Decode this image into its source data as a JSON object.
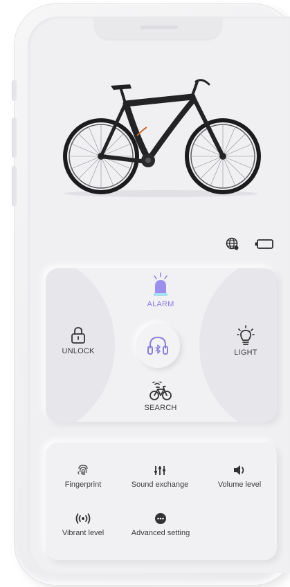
{
  "controls": {
    "alarm": "ALARM",
    "unlock": "UNLOCK",
    "light": "LIGHT",
    "search": "SEARCH"
  },
  "settings": {
    "items": [
      {
        "label": "Fingerprint",
        "icon": "fingerprint-icon"
      },
      {
        "label": "Sound exchange",
        "icon": "equalizer-icon"
      },
      {
        "label": "Volume level",
        "icon": "speaker-icon"
      },
      {
        "label": "Vibrant level",
        "icon": "vibration-icon"
      },
      {
        "label": "Advanced setting",
        "icon": "more-icon"
      }
    ]
  },
  "status": {
    "icons": [
      "globe-icon",
      "battery-icon"
    ]
  },
  "colors": {
    "accent": "#8a7de0",
    "background": "#f0f0f3",
    "text": "#3a3a3a"
  }
}
